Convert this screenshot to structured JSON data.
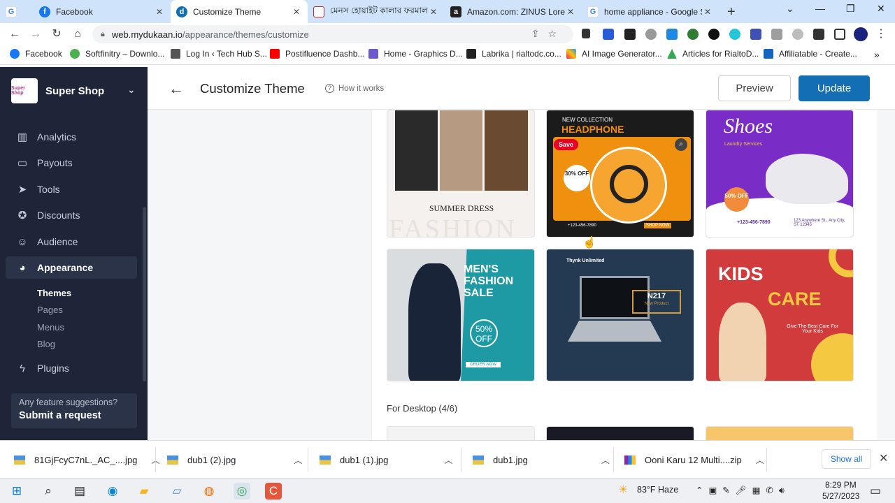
{
  "browser": {
    "tabs": [
      {
        "title": "Facebook",
        "color": "#1877f2",
        "glyph": "f",
        "active": false
      },
      {
        "title": "Customize Theme",
        "color": "#146eb4",
        "glyph": "d",
        "active": true
      },
      {
        "title": "মেনস হোয়াইট কালার ফরমাল",
        "color": "#c62828",
        "glyph": "",
        "active": false
      },
      {
        "title": "Amazon.com: ZINUS Lorela",
        "color": "#222222",
        "glyph": "a",
        "active": false
      },
      {
        "title": "home appliance - Google S",
        "color": "#4285f4",
        "glyph": "G",
        "active": false
      }
    ],
    "new_tab_label": "+",
    "url_host": "web.mydukaan.io",
    "url_path": "/appearance/themes/customize",
    "bookmarks": [
      {
        "label": "Facebook",
        "color": "#1877f2"
      },
      {
        "label": "Softfinitry – Downlo...",
        "color": "#4caf50"
      },
      {
        "label": "Log In ‹ Tech Hub S...",
        "color": "#555555"
      },
      {
        "label": "Postifluence Dashb...",
        "color": "#ff0000"
      },
      {
        "label": "Home - Graphics D...",
        "color": "#6a5acd"
      },
      {
        "label": "Labrika | rialtodc.co...",
        "color": "#222222"
      },
      {
        "label": "AI Image Generator...",
        "color": "#e91e63"
      },
      {
        "label": "Articles for RialtoD...",
        "color": "#34a853"
      },
      {
        "label": "Affiliatable - Create...",
        "color": "#1565c0"
      }
    ]
  },
  "sidebar": {
    "shop_name": "Super Shop",
    "logo_text": "Super Shop",
    "items": [
      {
        "label": "Analytics",
        "icon": "bar-chart-icon",
        "glyph": "▥"
      },
      {
        "label": "Payouts",
        "icon": "wallet-icon",
        "glyph": "▭"
      },
      {
        "label": "Tools",
        "icon": "cursor-icon",
        "glyph": "➤"
      },
      {
        "label": "Discounts",
        "icon": "discount-icon",
        "glyph": "✪"
      },
      {
        "label": "Audience",
        "icon": "users-icon",
        "glyph": "☺"
      },
      {
        "label": "Appearance",
        "icon": "palette-icon",
        "glyph": "◕"
      }
    ],
    "subitems": [
      "Themes",
      "Pages",
      "Menus",
      "Blog"
    ],
    "plugins_label": "Plugins",
    "feature_question": "Any feature suggestions?",
    "feature_cta": "Submit a request"
  },
  "header": {
    "title": "Customize Theme",
    "how_it_works": "How it works",
    "preview_label": "Preview",
    "update_label": "Update"
  },
  "content": {
    "banners": [
      {
        "name": "summer-dress",
        "caption": "SUMMER DRESS",
        "sub": "FASHION"
      },
      {
        "name": "headphone",
        "caption": "HEADPHONE",
        "sub": "NEW COLLECTION",
        "badge": "30% OFF",
        "save": "Save",
        "phone": "+123-456-7890",
        "cta": "SHOP NOW"
      },
      {
        "name": "shoes",
        "caption": "Shoes",
        "sub": "Laundry Services",
        "badge": "50% OFF",
        "phone": "+123-456-7890",
        "address": "123 Anywhere St., Any City, ST 12345"
      },
      {
        "name": "mens-fashion",
        "caption": "MEN'S FASHION SALE",
        "badge": "50% OFF",
        "cta": "ORDER NOW"
      },
      {
        "name": "laptop",
        "caption": "Thynk Unlimited",
        "model": "N217",
        "sub": "New Product"
      },
      {
        "name": "kids-care",
        "caption": "KIDS",
        "caption2": "CARE",
        "sub": "Give The Best Care For Your Kids"
      }
    ],
    "section_label": "For Desktop (4/6)"
  },
  "downloads": {
    "files": [
      "81GjFcyC7nL._AC_....jpg",
      "dub1 (2).jpg",
      "dub1 (1).jpg",
      "dub1.jpg",
      "Ooni Karu 12 Multi....zip"
    ],
    "show_all": "Show all"
  },
  "taskbar": {
    "weather": "83°F  Haze",
    "time": "8:29 PM",
    "date": "5/27/2023"
  }
}
